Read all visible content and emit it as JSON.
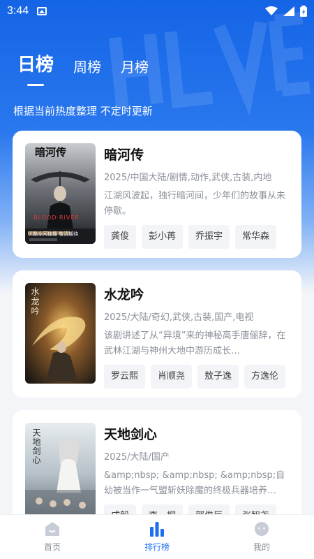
{
  "status_bar": {
    "time": "3:44"
  },
  "tabs": [
    {
      "label": "日榜",
      "active": true
    },
    {
      "label": "周榜",
      "active": false
    },
    {
      "label": "月榜",
      "active": false
    }
  ],
  "subtitle": "根据当前热度整理 不定时更新",
  "shows": [
    {
      "title": "暗河传",
      "meta": "2025/中国大陆/剧情,动作,武侠,古装,内地",
      "desc": "江湖风波起，独行暗河间，少年们的故事从未停歇。",
      "cast": [
        "龚俊",
        "彭小苒",
        "乔振宇",
        "常华森"
      ],
      "poster": {
        "title_text": "暗河传",
        "subtitle_text": "BLOOD·RIVER",
        "banner_text": "优酷全网独播 敬请期待"
      }
    },
    {
      "title": "水龙吟",
      "meta": "2025/大陆/奇幻,武侠,古装,国产,电视",
      "desc": "该剧讲述了从“异境”来的神秘高手唐俪辞，在武林江湖与神州大地中游历成长…",
      "cast": [
        "罗云熙",
        "肖顺尧",
        "敖子逸",
        "方逸伦"
      ],
      "poster": {
        "title_text": "水龙吟"
      }
    },
    {
      "title": "天地剑心",
      "meta": "2025/大陆/国产",
      "desc": "&amp;nbsp; &amp;nbsp; &amp;nbsp;自幼被当作一气盟斩妖除魔的终极兵器培养…",
      "cast": [
        "成毅",
        "李一桐",
        "郭俊辰",
        "张智尧"
      ],
      "poster": {
        "title_text": "天地剑心"
      }
    }
  ],
  "bottom_nav": [
    {
      "label": "首页",
      "icon": "home-icon",
      "active": false
    },
    {
      "label": "排行榜",
      "icon": "ranking-icon",
      "active": true
    },
    {
      "label": "我的",
      "icon": "profile-icon",
      "active": false
    }
  ],
  "colors": {
    "accent": "#1e6ff0",
    "hero": "#1464e6"
  }
}
